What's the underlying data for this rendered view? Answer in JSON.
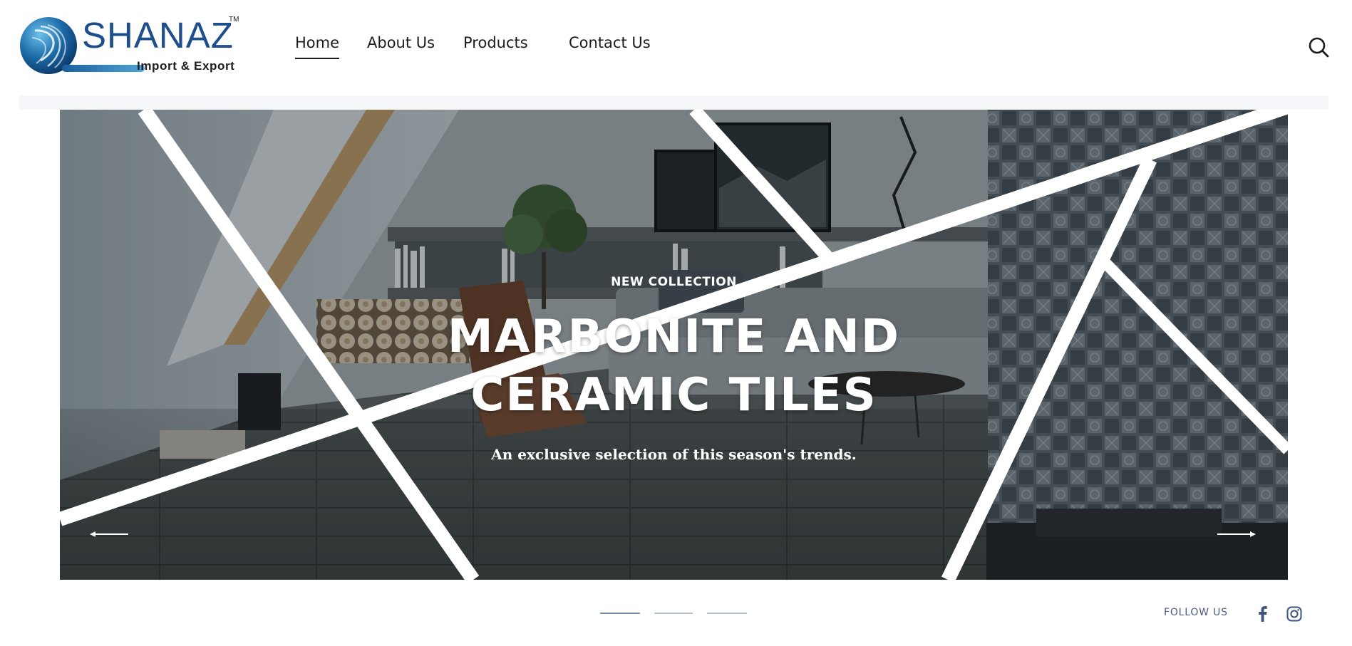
{
  "brand": {
    "name": "SHANAZ",
    "trademark": "TM",
    "tagline": "Import & Export"
  },
  "nav": {
    "items": [
      {
        "label": "Home",
        "active": true
      },
      {
        "label": "About Us",
        "active": false
      },
      {
        "label": "Products",
        "active": false
      },
      {
        "label": "Contact Us",
        "active": false
      }
    ]
  },
  "hero": {
    "eyebrow": "NEW COLLECTION",
    "headline_line1": "MARBONITE AND",
    "headline_line2": "CERAMIC TILES",
    "tagline": "An exclusive selection of this season's trends."
  },
  "slider": {
    "slide_count": 3,
    "active_index": 0
  },
  "social": {
    "label": "FOLLOW US",
    "icons": [
      "facebook-icon",
      "instagram-icon"
    ]
  },
  "colors": {
    "brand_blue": "#1f4e8c",
    "text_dark": "#1c1c1c",
    "follow_text": "#4a5c80"
  }
}
